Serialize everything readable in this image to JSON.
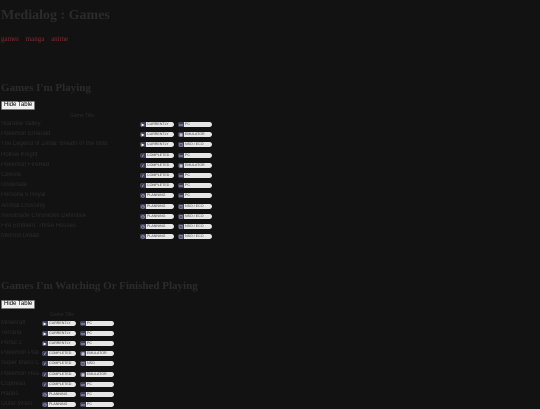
{
  "page": {
    "title": "Medialog : Games"
  },
  "nav": {
    "items": [
      "games",
      "manga",
      "anime"
    ]
  },
  "sections": [
    {
      "title": "Games I'm Playing",
      "toggle_label": "Hide Table",
      "column_header": "Game Title",
      "rows": [
        {
          "name": "Stardew Valley",
          "status": "CURRENTLY",
          "status_icon": "play-icon",
          "platform": "PC",
          "platform_icon": "monitor-icon"
        },
        {
          "name": "Pokemon Emerald",
          "status": "CURRENTLY",
          "status_icon": "play-icon",
          "platform": "EMULATOR",
          "platform_icon": "chip-icon"
        },
        {
          "name": "The Legend of Zelda: Breath of the Wild",
          "status": "CURRENTLY",
          "status_icon": "play-icon",
          "platform": "NSO / ECO",
          "platform_icon": "switch-icon"
        },
        {
          "name": "Hollow Knight",
          "status": "COMPLETED",
          "status_icon": "check-icon",
          "platform": "PC",
          "platform_icon": "monitor-icon"
        },
        {
          "name": "Pokemon FireRed",
          "status": "COMPLETED",
          "status_icon": "check-icon",
          "platform": "EMULATOR",
          "platform_icon": "chip-icon"
        },
        {
          "name": "Celeste",
          "status": "COMPLETED",
          "status_icon": "check-icon",
          "platform": "PC",
          "platform_icon": "monitor-icon"
        },
        {
          "name": "Undertale",
          "status": "COMPLETED",
          "status_icon": "check-icon",
          "platform": "PC",
          "platform_icon": "monitor-icon"
        },
        {
          "name": "Persona 5 Royal",
          "status": "PLANNING",
          "status_icon": "clock-icon",
          "platform": "PC",
          "platform_icon": "monitor-icon"
        },
        {
          "name": "Animal Crossing",
          "status": "PLANNING",
          "status_icon": "clock-icon",
          "platform": "NSO / ECO",
          "platform_icon": "switch-icon"
        },
        {
          "name": "Xenoblade Chronicles Definitive",
          "status": "PLANNING",
          "status_icon": "clock-icon",
          "platform": "NSO / ECO",
          "platform_icon": "switch-icon"
        },
        {
          "name": "Fire Emblem: Three Houses",
          "status": "PLANNING",
          "status_icon": "clock-icon",
          "platform": "NSO / ECO",
          "platform_icon": "switch-icon"
        },
        {
          "name": "Metroid Dread",
          "status": "PLANNING",
          "status_icon": "clock-icon",
          "platform": "NSO / ECO",
          "platform_icon": "switch-icon"
        }
      ]
    },
    {
      "title": "Games I'm Watching Or Finished Playing",
      "toggle_label": "Hide Table",
      "column_header": "Game Title",
      "rows": [
        {
          "name": "Minecraft",
          "status": "CURRENTLY",
          "status_icon": "play-icon",
          "platform": "PC",
          "platform_icon": "monitor-icon"
        },
        {
          "name": "Terraria",
          "status": "CURRENTLY",
          "status_icon": "play-icon",
          "platform": "PC",
          "platform_icon": "monitor-icon"
        },
        {
          "name": "Portal 2",
          "status": "CURRENTLY",
          "status_icon": "play-icon",
          "platform": "PC",
          "platform_icon": "monitor-icon"
        },
        {
          "name": "Pokemon Platinum",
          "status": "COMPLETED",
          "status_icon": "check-icon",
          "platform": "EMULATOR",
          "platform_icon": "chip-icon"
        },
        {
          "name": "Super Mario Odyssey",
          "status": "COMPLETED",
          "status_icon": "check-icon",
          "platform": "NSO",
          "platform_icon": "switch-icon"
        },
        {
          "name": "Pokemon HeartGold",
          "status": "COMPLETED",
          "status_icon": "check-icon",
          "platform": "EMULATOR",
          "platform_icon": "chip-icon"
        },
        {
          "name": "Cuphead",
          "status": "COMPLETED",
          "status_icon": "check-icon",
          "platform": "PC",
          "platform_icon": "monitor-icon"
        },
        {
          "name": "Hades",
          "status": "PLANNING",
          "status_icon": "clock-icon",
          "platform": "PC",
          "platform_icon": "monitor-icon"
        },
        {
          "name": "Outer Wilds",
          "status": "PLANNING",
          "status_icon": "clock-icon",
          "platform": "PC",
          "platform_icon": "monitor-icon"
        }
      ]
    }
  ],
  "colors": {
    "background": "#121212",
    "nav_link": "#8a2b2b",
    "badge_bg": "#e6e6e6",
    "badge_icon": "#3c3c5a"
  },
  "icon_glyphs": {
    "play-icon": "▶",
    "check-icon": "✓",
    "clock-icon": "◷",
    "monitor-icon": "▭",
    "chip-icon": "▦",
    "switch-icon": "◫"
  }
}
